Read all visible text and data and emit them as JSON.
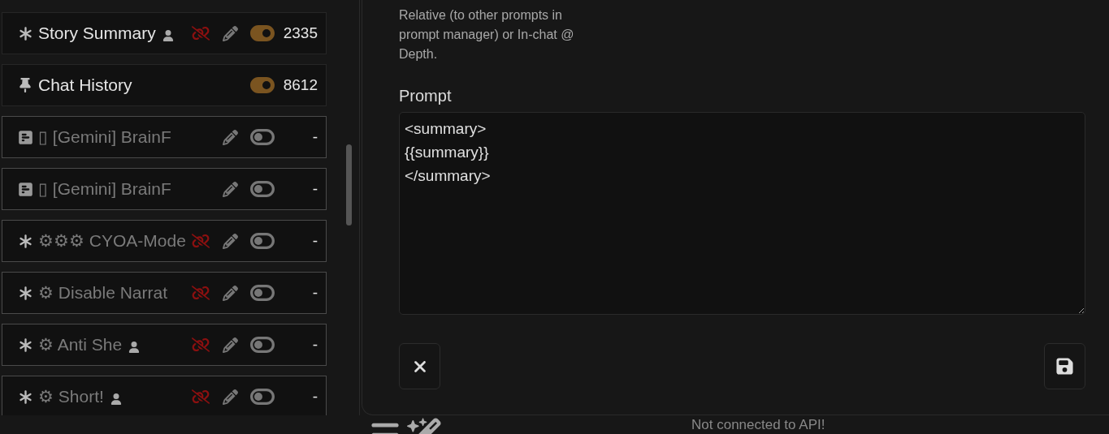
{
  "prompts": [
    {
      "kind": "asterisk",
      "name": "Story Summary",
      "user_marker": true,
      "unlinked": true,
      "editable": true,
      "enabled": true,
      "tokens": "2335"
    },
    {
      "kind": "pin",
      "name": "Chat History",
      "user_marker": false,
      "unlinked": false,
      "editable": false,
      "enabled": true,
      "tokens": "8612"
    },
    {
      "kind": "document",
      "name": "▯ [Gemini] BrainF",
      "user_marker": false,
      "unlinked": false,
      "editable": true,
      "enabled": false,
      "tokens": "-"
    },
    {
      "kind": "document",
      "name": "▯ [Gemini] BrainF",
      "user_marker": false,
      "unlinked": false,
      "editable": true,
      "enabled": false,
      "tokens": "-"
    },
    {
      "kind": "asterisk",
      "name": "⚙⚙⚙ CYOA-Mode",
      "user_marker": false,
      "unlinked": true,
      "editable": true,
      "enabled": false,
      "tokens": "-"
    },
    {
      "kind": "asterisk",
      "name": "⚙ Disable Narrat",
      "user_marker": false,
      "unlinked": true,
      "editable": true,
      "enabled": false,
      "tokens": "-"
    },
    {
      "kind": "asterisk",
      "name": "⚙ Anti She",
      "user_marker": true,
      "unlinked": true,
      "editable": true,
      "enabled": false,
      "tokens": "-"
    },
    {
      "kind": "asterisk",
      "name": "⚙ Short!",
      "user_marker": true,
      "unlinked": true,
      "editable": true,
      "enabled": false,
      "tokens": "-"
    }
  ],
  "editor": {
    "position_hint": "Relative (to other prompts in prompt manager) or In-chat @ Depth.",
    "prompt_label": "Prompt",
    "prompt_value": "<summary>\n{{summary}}\n</summary>"
  },
  "status_bar": {
    "connection": "Not connected to API!"
  }
}
